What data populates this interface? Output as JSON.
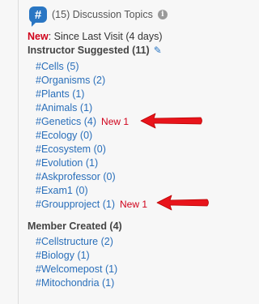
{
  "header": {
    "icon": "hash-icon",
    "topic_count_text": "(15) Discussion Topics",
    "info_icon": "info-icon"
  },
  "since": {
    "new_label": "New",
    "text": ": Since Last Visit (4 days)"
  },
  "instructor": {
    "title": "Instructor Suggested (11)",
    "edit_icon": "pencil-icon",
    "items": [
      {
        "label": "#Cells",
        "count": "(5)",
        "new": ""
      },
      {
        "label": "#Organisms",
        "count": "(2)",
        "new": ""
      },
      {
        "label": "#Plants",
        "count": "(1)",
        "new": ""
      },
      {
        "label": "#Animals",
        "count": "(1)",
        "new": ""
      },
      {
        "label": "#Genetics",
        "count": "(4)",
        "new": "New 1"
      },
      {
        "label": "#Ecology",
        "count": "(0)",
        "new": ""
      },
      {
        "label": "#Ecosystem",
        "count": "(0)",
        "new": ""
      },
      {
        "label": "#Evolution",
        "count": "(1)",
        "new": ""
      },
      {
        "label": "#Askprofessor",
        "count": "(0)",
        "new": ""
      },
      {
        "label": "#Exam1",
        "count": "(0)",
        "new": ""
      },
      {
        "label": "#Groupproject",
        "count": "(1)",
        "new": "New 1"
      }
    ]
  },
  "member": {
    "title": "Member Created (4)",
    "items": [
      {
        "label": "#Cellstructure",
        "count": "(2)"
      },
      {
        "label": "#Biology",
        "count": "(1)"
      },
      {
        "label": "#Welcomepost",
        "count": "(1)"
      },
      {
        "label": "#Mitochondria",
        "count": "(1)"
      }
    ]
  },
  "colors": {
    "link": "#2a6fba",
    "new": "#d0021b",
    "arrow": "#e8141b",
    "badge": "#2a76c3"
  }
}
